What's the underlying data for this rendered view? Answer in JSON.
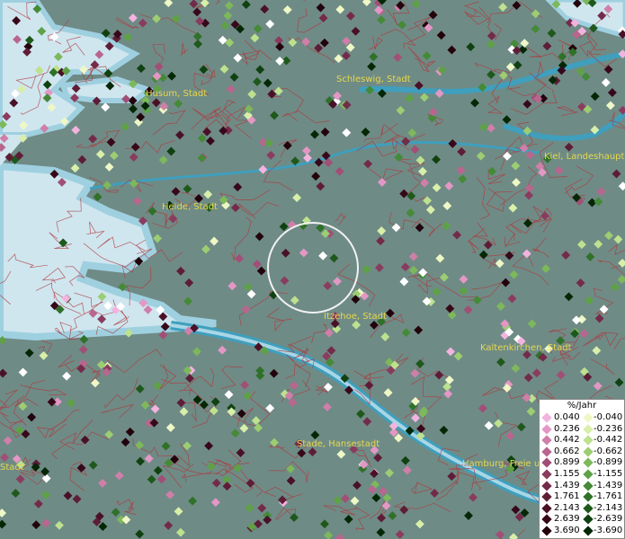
{
  "places": [
    {
      "name": "Husum, Stadt"
    },
    {
      "name": "Schleswig, Stadt"
    },
    {
      "name": "Kiel, Landeshaupts"
    },
    {
      "name": "Heide, Stadt"
    },
    {
      "name": "Itzehoe, Stadt"
    },
    {
      "name": "Kaltenkirchen, Stadt"
    },
    {
      "name": "Stade, Hansestadt"
    },
    {
      "name": "Hamburg, Freie u"
    },
    {
      "name": "Stadt"
    }
  ],
  "legend": {
    "title": "%/Jahr",
    "positive": [
      {
        "label": "0.040",
        "color": "#f3b3df"
      },
      {
        "label": "0.236",
        "color": "#e397c4"
      },
      {
        "label": "0.442",
        "color": "#cf7fa9"
      },
      {
        "label": "0.662",
        "color": "#b9668f"
      },
      {
        "label": "0.899",
        "color": "#a14f76"
      },
      {
        "label": "1.155",
        "color": "#8a3c5e"
      },
      {
        "label": "1.439",
        "color": "#732b49"
      },
      {
        "label": "1.761",
        "color": "#5e1d36"
      },
      {
        "label": "2.143",
        "color": "#4a1126"
      },
      {
        "label": "2.639",
        "color": "#370819"
      },
      {
        "label": "3.690",
        "color": "#22020b"
      }
    ],
    "negative": [
      {
        "label": "-0.040",
        "color": "#eef7c6"
      },
      {
        "label": "-0.236",
        "color": "#d8efaa"
      },
      {
        "label": "-0.442",
        "color": "#bde18e"
      },
      {
        "label": "-0.662",
        "color": "#9ccd72"
      },
      {
        "label": "-0.899",
        "color": "#7db85b"
      },
      {
        "label": "-1.155",
        "color": "#5fa147"
      },
      {
        "label": "-1.439",
        "color": "#458a37"
      },
      {
        "label": "-1.761",
        "color": "#2f7128"
      },
      {
        "label": "-2.143",
        "color": "#1e591b"
      },
      {
        "label": "-2.639",
        "color": "#104110"
      },
      {
        "label": "-3.690",
        "color": "#042705"
      }
    ]
  }
}
